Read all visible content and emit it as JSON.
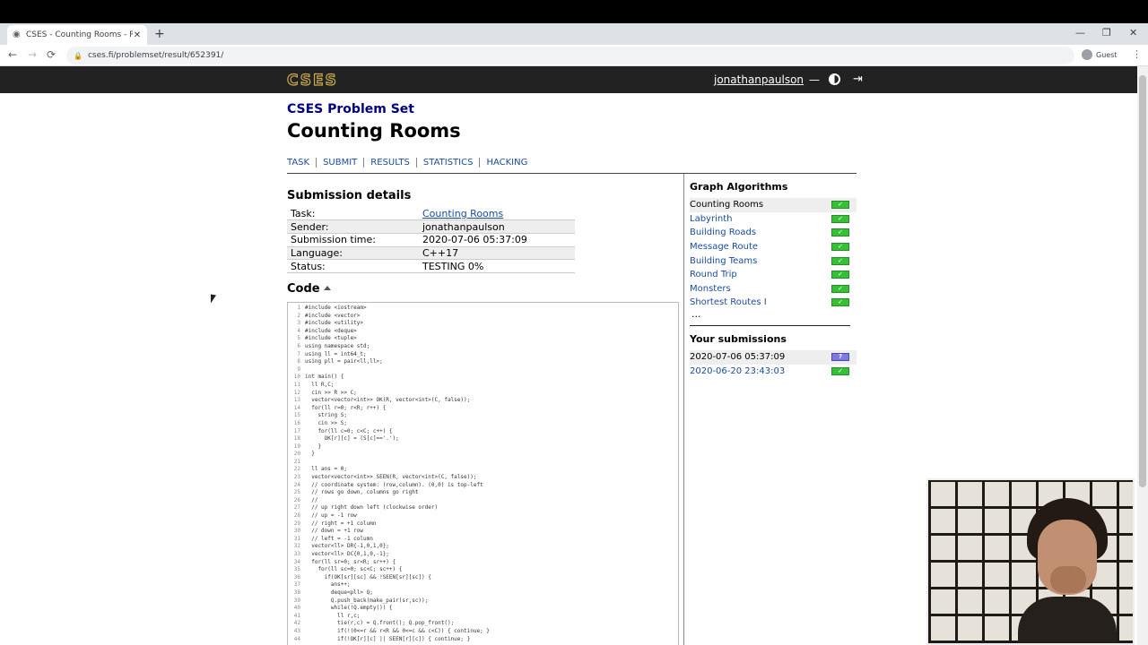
{
  "browser": {
    "tab_title": "CSES - Counting Rooms - Results",
    "tab_close": "✕",
    "new_tab": "+",
    "url": "cses.fi/problemset/result/652391/",
    "profile_label": "Guest",
    "nav_back": "←",
    "nav_forward": "→",
    "nav_reload": "⟳",
    "win_minimize": "—",
    "win_restore": "❐",
    "win_close": "✕"
  },
  "header": {
    "logo": "CSES",
    "username": "jonathanpaulson",
    "dash": "—",
    "logout_glyph": "⇥"
  },
  "page": {
    "problemset": "CSES Problem Set",
    "title": "Counting Rooms",
    "nav": [
      "TASK",
      "SUBMIT",
      "RESULTS",
      "STATISTICS",
      "HACKING"
    ]
  },
  "submission": {
    "heading": "Submission details",
    "rows": [
      {
        "key": "Task:",
        "value": "Counting Rooms"
      },
      {
        "key": "Sender:",
        "value": "jonathanpaulson"
      },
      {
        "key": "Submission time:",
        "value": "2020-07-06 05:37:09"
      },
      {
        "key": "Language:",
        "value": "C++17"
      },
      {
        "key": "Status:",
        "value": "TESTING 0%"
      }
    ]
  },
  "code": {
    "heading": "Code",
    "lines": [
      "#include <iostream>",
      "#include <vector>",
      "#include <utility>",
      "#include <deque>",
      "#include <tuple>",
      "using namespace std;",
      "using ll = int64_t;",
      "using pll = pair<ll,ll>;",
      "",
      "int main() {",
      "  ll R,C;",
      "  cin >> R >> C;",
      "  vector<vector<int>> OK(R, vector<int>(C, false));",
      "  for(ll r=0; r<R; r++) {",
      "    string S;",
      "    cin >> S;",
      "    for(ll c=0; c<C; c++) {",
      "      OK[r][c] = (S[c]=='.');",
      "    }",
      "  }",
      "",
      "  ll ans = 0;",
      "  vector<vector<int>> SEEN(R, vector<int>(C, false));",
      "  // coordinate system: (row,column). (0,0) is top-left",
      "  // rows go down, columns go right",
      "  //",
      "  // up right down left (clockwise order)",
      "  // up = -1 row",
      "  // right = +1 column",
      "  // down = +1 row",
      "  // left = -1 column",
      "  vector<ll> DR{-1,0,1,0};",
      "  vector<ll> DC{0,1,0,-1};",
      "  for(ll sr=0; sr<R; sr++) {",
      "    for(ll sc=0; sc<C; sc++) {",
      "      if(OK[sr][sc] && !SEEN[sr][sc]) {",
      "        ans++;",
      "        deque<pll> Q;",
      "        Q.push_back(make_pair(sr,sc));",
      "        while(!Q.empty()) {",
      "          ll r,c;",
      "          tie(r,c) = Q.front(); Q.pop_front();",
      "          if(!(0<=r && r<R && 0<=c && c<C)) { continue; }",
      "          if(!OK[r][c] || SEEN[r][c]) { continue; }"
    ]
  },
  "sidebar": {
    "heading": "Graph Algorithms",
    "items": [
      {
        "label": "Counting Rooms",
        "status": "✓"
      },
      {
        "label": "Labyrinth",
        "status": "✓"
      },
      {
        "label": "Building Roads",
        "status": "✓"
      },
      {
        "label": "Message Route",
        "status": "✓"
      },
      {
        "label": "Building Teams",
        "status": "✓"
      },
      {
        "label": "Round Trip",
        "status": "✓"
      },
      {
        "label": "Monsters",
        "status": "✓"
      },
      {
        "label": "Shortest Routes I",
        "status": "✓"
      }
    ],
    "more": "...",
    "submissions_heading": "Your submissions",
    "submissions": [
      {
        "time": "2020-07-06 05:37:09",
        "status": "?"
      },
      {
        "time": "2020-06-20 23:43:03",
        "status": "✓"
      }
    ]
  },
  "colors": {
    "header_bg": "#222222",
    "logo_gold": "#c9a94d",
    "link_blue": "#1a4b9b",
    "accepted_green": "#34c234",
    "pending_purple": "#7a7ae0"
  }
}
